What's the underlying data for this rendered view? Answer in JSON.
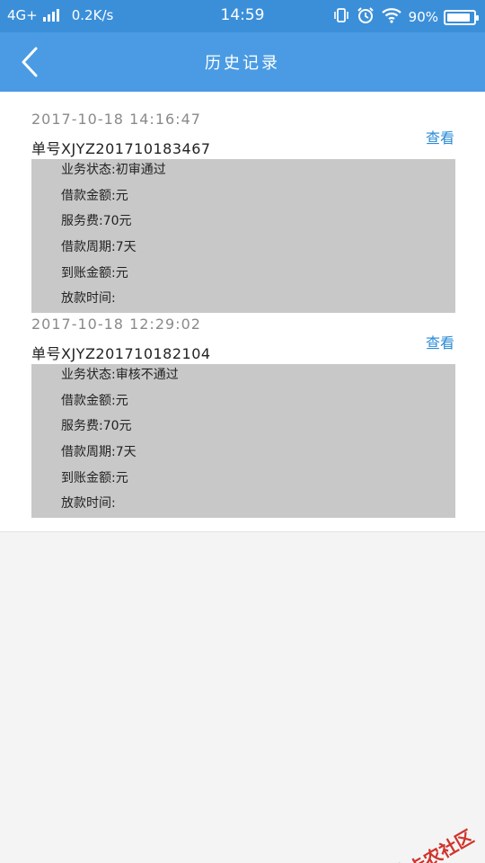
{
  "status_bar": {
    "network": "4G+",
    "speed": "0.2K/s",
    "time": "14:59",
    "battery": "90%",
    "battery_level": 0.9
  },
  "header": {
    "title": "历史记录"
  },
  "records": [
    {
      "time": "2017-10-18  14:16:47",
      "order_no": "单号XJYZ201710183467",
      "view_label": "查看",
      "details": [
        "业务状态:初审通过",
        "借款金额:元",
        "服务费:70元",
        "借款周期:7天",
        "到账金额:元",
        "放款时间:"
      ]
    },
    {
      "time": "2017-10-18  12:29:02",
      "order_no": "单号XJYZ201710182104",
      "view_label": "查看",
      "details": [
        "业务状态:审核不通过",
        "借款金额:元",
        "服务费:70元",
        "借款周期:7天",
        "到账金额:元",
        "放款时间:"
      ]
    }
  ],
  "watermark": "卡农社区"
}
